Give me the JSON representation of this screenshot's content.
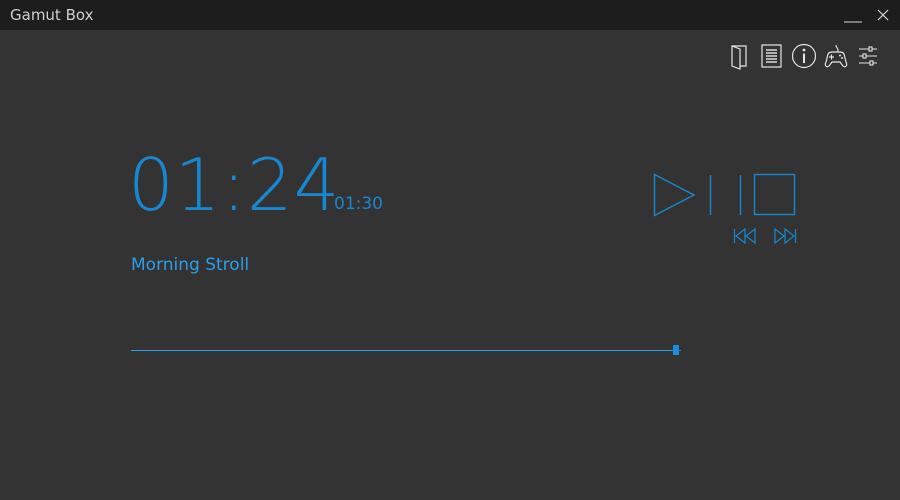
{
  "window": {
    "title": "Gamut Box"
  },
  "titlebar": {
    "minimize_icon": "minimize-icon",
    "close_icon": "close-icon"
  },
  "toolbar": {
    "icons": [
      "book-icon",
      "document-list-icon",
      "info-icon",
      "gamepad-icon",
      "settings-sliders-icon"
    ]
  },
  "player": {
    "elapsed": "01:24",
    "total": "01:30",
    "track_title": "Morning Stroll",
    "progress_fraction": 0.99
  },
  "controls": {
    "icons": [
      "play-icon",
      "pause-icon",
      "stop-icon",
      "previous-track-icon",
      "next-track-icon"
    ]
  },
  "colors": {
    "accent": "#1787cf",
    "background": "#333333",
    "titlebar": "#1d1d1d",
    "icon": "#e6e6e6"
  }
}
